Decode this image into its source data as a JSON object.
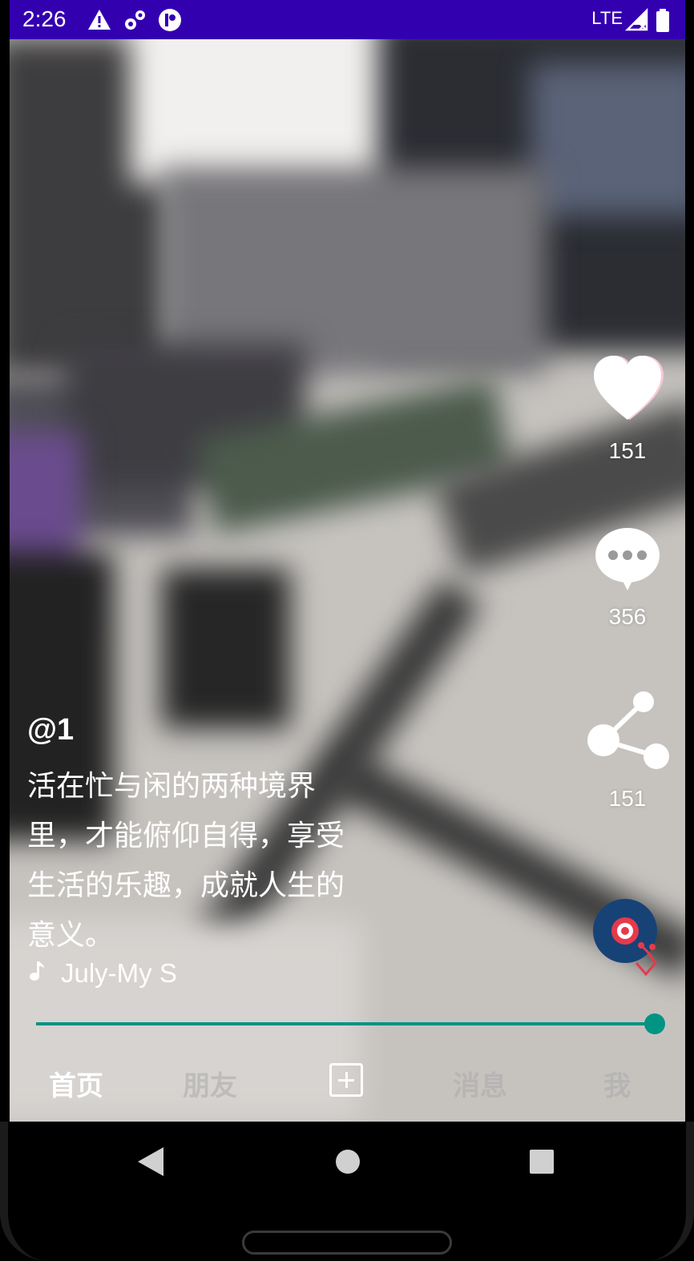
{
  "status_bar": {
    "time": "2:26",
    "network": "LTE",
    "icons": [
      "warning-icon",
      "settings-gear-icon",
      "app-notification-icon",
      "signal-icon",
      "battery-icon"
    ]
  },
  "actions": {
    "like": {
      "icon": "heart-icon",
      "count": "151"
    },
    "comment": {
      "icon": "comment-bubble-icon",
      "count": "356"
    },
    "share": {
      "icon": "share-icon",
      "count": "151"
    },
    "music_disc": {
      "icon": "vinyl-disc-icon"
    }
  },
  "post": {
    "author": "@1",
    "description": "活在忙与闲的两种境界里，才能俯仰自得，享受生活的乐趣，成就人生的意义。",
    "music_title": "July-My S",
    "music_icon": "music-note-icon"
  },
  "progress": {
    "value_fraction": 1.0,
    "color": "#009483"
  },
  "tabs": [
    {
      "label": "首页",
      "active": true
    },
    {
      "label": "朋友",
      "active": false
    },
    {
      "label": "",
      "icon": "add-icon"
    },
    {
      "label": "消息",
      "active": false
    },
    {
      "label": "我",
      "active": false
    }
  ],
  "colors": {
    "status_bar": "#3300b0",
    "accent": "#009483"
  },
  "nav_icons": [
    "back-icon",
    "home-icon",
    "recents-icon"
  ]
}
